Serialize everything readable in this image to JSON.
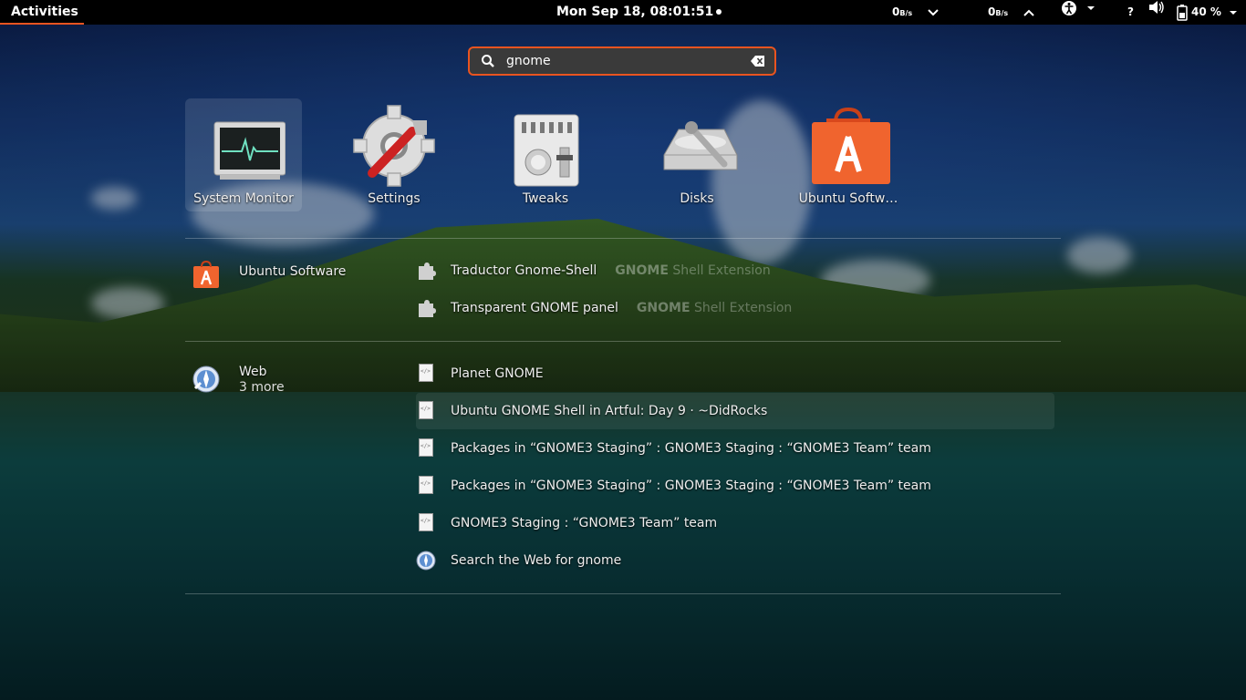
{
  "topbar": {
    "activities_label": "Activities",
    "clock": "Mon Sep 18, 08:01:51",
    "net_down_value": "0",
    "net_down_unit": "B/s",
    "net_up_value": "0",
    "net_up_unit": "B/s",
    "help_label": "?",
    "battery_label": "40 %"
  },
  "search": {
    "value": "gnome"
  },
  "apps": [
    {
      "label": "System Monitor"
    },
    {
      "label": "Settings"
    },
    {
      "label": "Tweaks"
    },
    {
      "label": "Disks"
    },
    {
      "label": "Ubuntu Softw…"
    }
  ],
  "software_provider": {
    "name": "Ubuntu Software",
    "results": [
      {
        "title": "Traductor Gnome-Shell",
        "desc_bold": "GNOME",
        "desc_rest": " Shell Extension"
      },
      {
        "title": "Transparent GNOME panel",
        "desc_bold": "GNOME",
        "desc_rest": " Shell Extension"
      }
    ]
  },
  "web_provider": {
    "name": "Web",
    "more": "3 more",
    "results": [
      {
        "title": "Planet GNOME"
      },
      {
        "title": "Ubuntu GNOME Shell in Artful: Day 9 · ~DidRocks"
      },
      {
        "title": "Packages in “GNOME3 Staging” : GNOME3 Staging : “GNOME3 Team” team"
      },
      {
        "title": "Packages in “GNOME3 Staging” : GNOME3 Staging : “GNOME3 Team” team"
      },
      {
        "title": "GNOME3 Staging : “GNOME3 Team” team"
      },
      {
        "title": "Search the Web for gnome"
      }
    ]
  },
  "colors": {
    "accent": "#e95420",
    "topbar_bg": "#000000"
  }
}
